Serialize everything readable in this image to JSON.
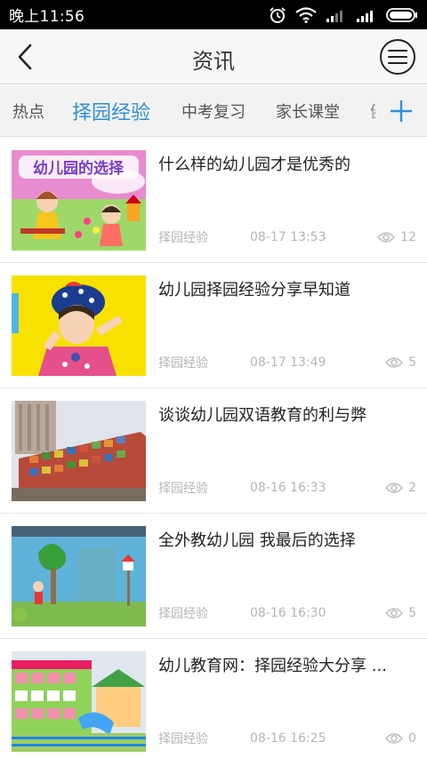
{
  "status_bar": {
    "time": "晚上11:56"
  },
  "nav": {
    "title": "资讯"
  },
  "tabs": [
    {
      "label": "热点",
      "active": false
    },
    {
      "label": "择园经验",
      "active": true
    },
    {
      "label": "中考复习",
      "active": false
    },
    {
      "label": "家长课堂",
      "active": false
    },
    {
      "label": "健",
      "active": false
    }
  ],
  "articles": [
    {
      "title": "什么样的幼儿园才是优秀的",
      "category": "择园经验",
      "time": "08-17 13:53",
      "views": "12",
      "thumb_text": "幼儿园的选择"
    },
    {
      "title": "幼儿园择园经验分享早知道",
      "category": "择园经验",
      "time": "08-17 13:49",
      "views": "5"
    },
    {
      "title": "谈谈幼儿园双语教育的利与弊",
      "category": "择园经验",
      "time": "08-16 16:33",
      "views": "2"
    },
    {
      "title": "全外教幼儿园 我最后的选择",
      "category": "择园经验",
      "time": "08-16 16:30",
      "views": "5"
    },
    {
      "title": "幼儿教育网：择园经验大分享 ...",
      "category": "择园经验",
      "time": "08-16 16:25",
      "views": "0"
    }
  ],
  "colors": {
    "accent": "#2f8fd8",
    "meta_text": "#b5b5b5",
    "title_text": "#222222"
  }
}
